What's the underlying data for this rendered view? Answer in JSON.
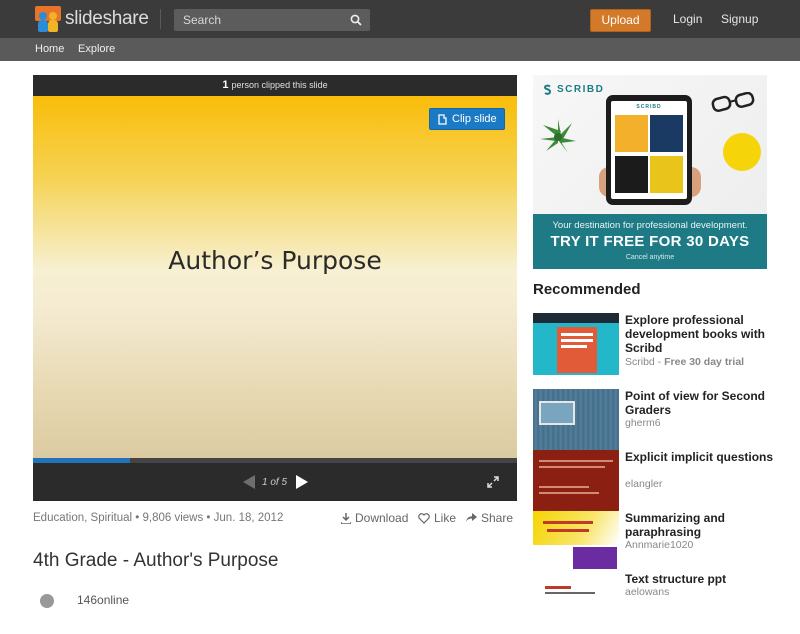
{
  "header": {
    "logo_text": "slideshare",
    "search_placeholder": "Search",
    "upload_label": "Upload",
    "login_label": "Login",
    "signup_label": "Signup"
  },
  "subnav": {
    "home_label": "Home",
    "explore_label": "Explore"
  },
  "player": {
    "clip_count": "1",
    "clip_text": "person clipped this slide",
    "clip_button_label": "Clip slide",
    "slide_title": "Author’s Purpose",
    "page_counter": "1 of 5",
    "progress_fraction": 0.2
  },
  "meta": {
    "info": "Education, Spiritual • 9,806 views • Jun. 18, 2012",
    "download_label": "Download",
    "like_label": "Like",
    "share_label": "Share"
  },
  "document": {
    "title": "4th Grade - Author's Purpose",
    "author": "146online"
  },
  "ad": {
    "brand": "SCRIBD",
    "tablet_brand": "SCRIBD",
    "line1": "Your destination for professional development.",
    "line2_a": "TRY IT ",
    "line2_b": "FREE",
    "line2_c": " FOR 30 DAYS",
    "line3": "Cancel anytime",
    "accent": "#1e7b85"
  },
  "recommended": {
    "heading": "Recommended",
    "items": [
      {
        "title": "Explore professional development books with Scribd",
        "source": "Scribd",
        "extra": "Free 30 day trial"
      },
      {
        "title": "Point of view for Second Graders",
        "source": "gherm6",
        "extra": ""
      },
      {
        "title": "Explicit implicit questions",
        "source": "elangler",
        "extra": ""
      },
      {
        "title": "Summarizing and paraphrasing",
        "source": "Annmarie1020",
        "extra": ""
      },
      {
        "title": "Text structure ppt",
        "source": "aelowans",
        "extra": ""
      }
    ]
  },
  "colors": {
    "header_bg": "#3b3b3b",
    "upload_orange": "#d37a2a",
    "clip_blue": "#1a7ac6"
  }
}
